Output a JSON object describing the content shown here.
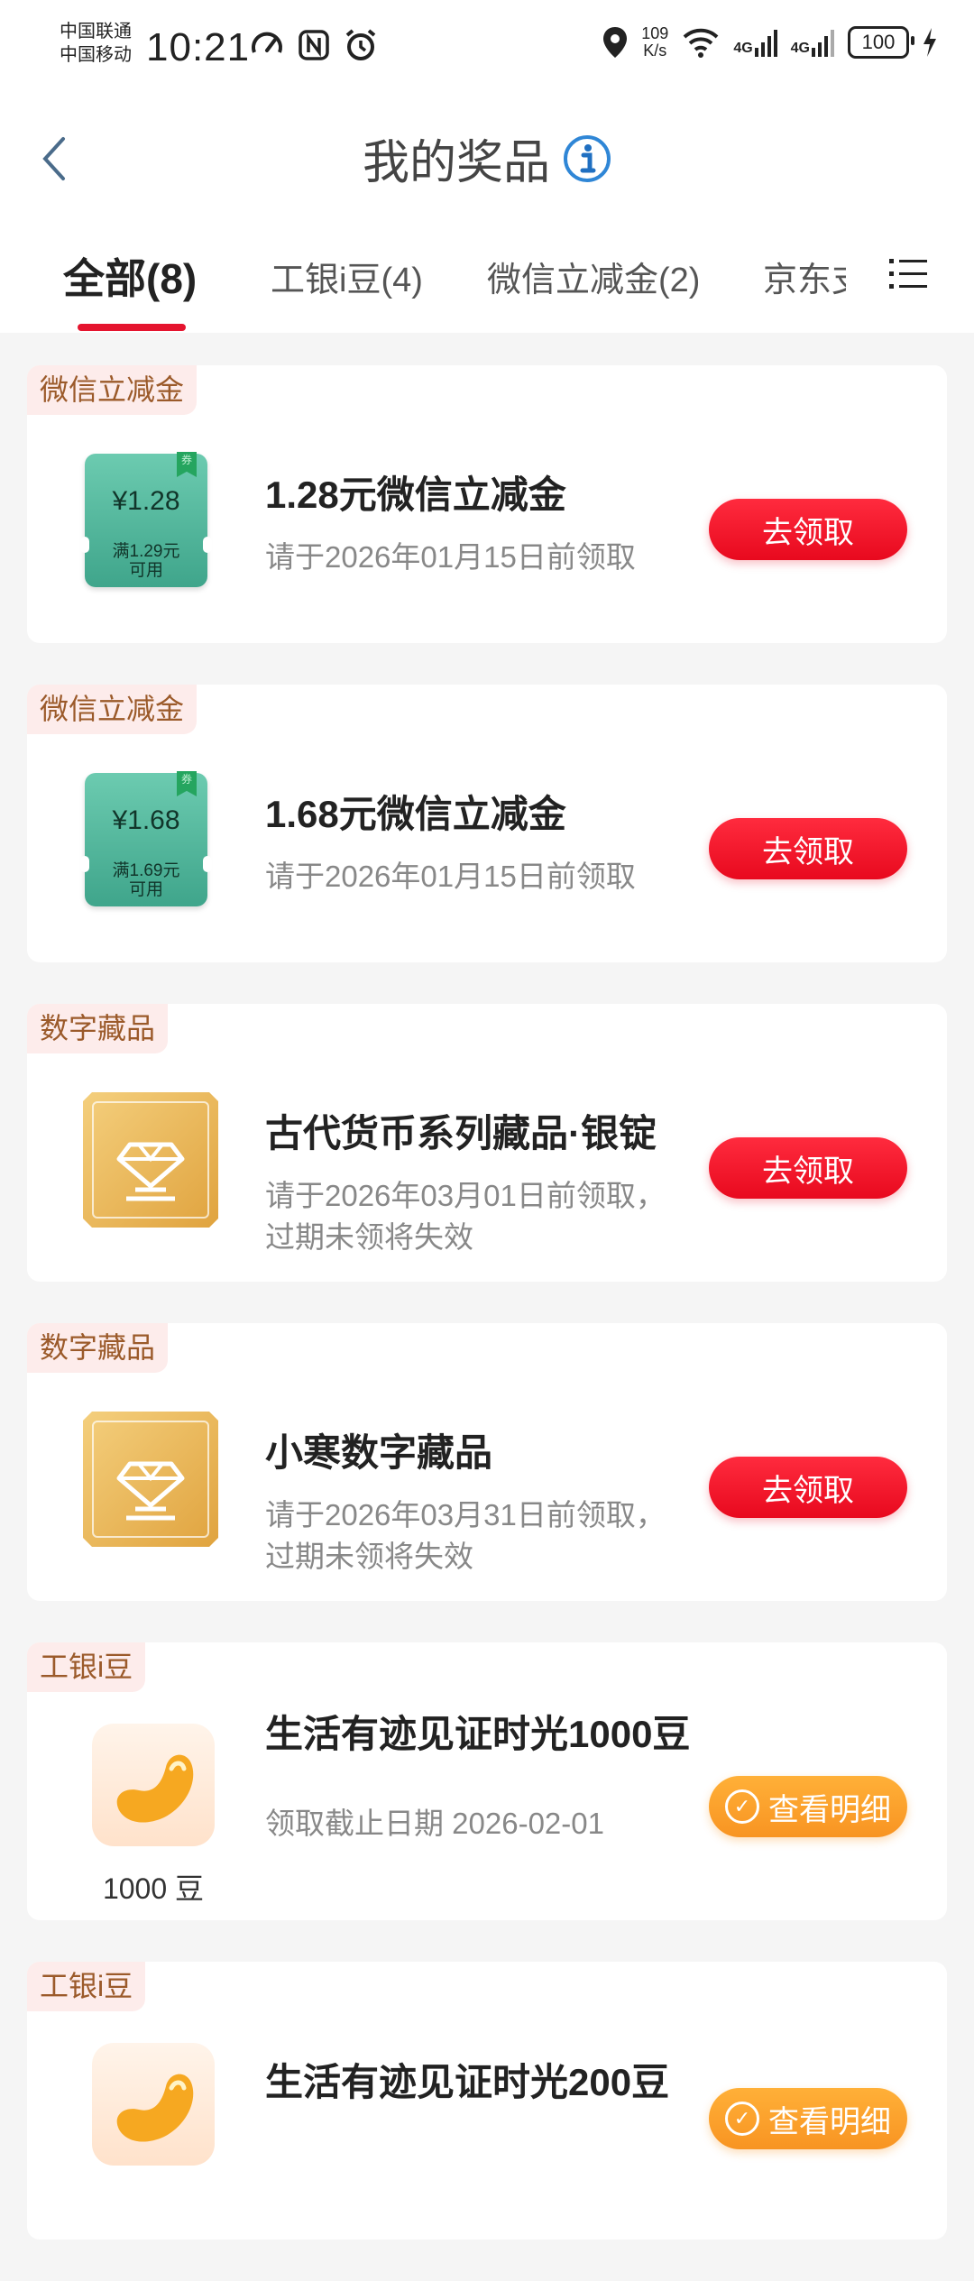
{
  "status_bar": {
    "carrier_1": "中国联通",
    "carrier_2": "中国移动",
    "time": "10:21",
    "net_speed_value": "109",
    "net_speed_unit": "K/s",
    "signal_1": "4G",
    "signal_2": "4G",
    "battery": "100"
  },
  "header": {
    "title": "我的奖品"
  },
  "tabs": [
    {
      "label": "全部(8)",
      "active": true
    },
    {
      "label": "工银i豆(4)"
    },
    {
      "label": "微信立减金(2)"
    },
    {
      "label": "京东支"
    }
  ],
  "cards": [
    {
      "tag": "微信立减金",
      "thumb": "coupon",
      "coupon_amount": "¥1.28",
      "coupon_cond_1": "满1.29元",
      "coupon_cond_2": "可用",
      "coupon_flag": "券",
      "title": "1.28元微信立减金",
      "subtitle": "请于2026年01月15日前领取",
      "button": "去领取"
    },
    {
      "tag": "微信立减金",
      "thumb": "coupon",
      "coupon_amount": "¥1.68",
      "coupon_cond_1": "满1.69元",
      "coupon_cond_2": "可用",
      "coupon_flag": "券",
      "title": "1.68元微信立减金",
      "subtitle": "请于2026年01月15日前领取",
      "button": "去领取"
    },
    {
      "tag": "数字藏品",
      "thumb": "collectible",
      "title": "古代货币系列藏品·银锭",
      "subtitle": "请于2026年03月01日前领取，过期未领将失效",
      "button": "去领取"
    },
    {
      "tag": "数字藏品",
      "thumb": "collectible",
      "title": "小寒数字藏品",
      "subtitle": "请于2026年03月31日前领取，过期未领将失效",
      "button": "去领取"
    },
    {
      "tag": "工银i豆",
      "thumb": "bean",
      "bean_qty": "1000 豆",
      "title": "生活有迹见证时光1000豆",
      "subtitle": "领取截止日期 2026-02-01",
      "button": "查看明细"
    },
    {
      "tag": "工银i豆",
      "thumb": "bean",
      "title": "生活有迹见证时光200豆",
      "button": "查看明细"
    }
  ],
  "colors": {
    "accent_red": "#e8091e",
    "accent_orange": "#f89422",
    "tag_bg": "#fdeceb",
    "tag_text": "#9b5a2a"
  }
}
